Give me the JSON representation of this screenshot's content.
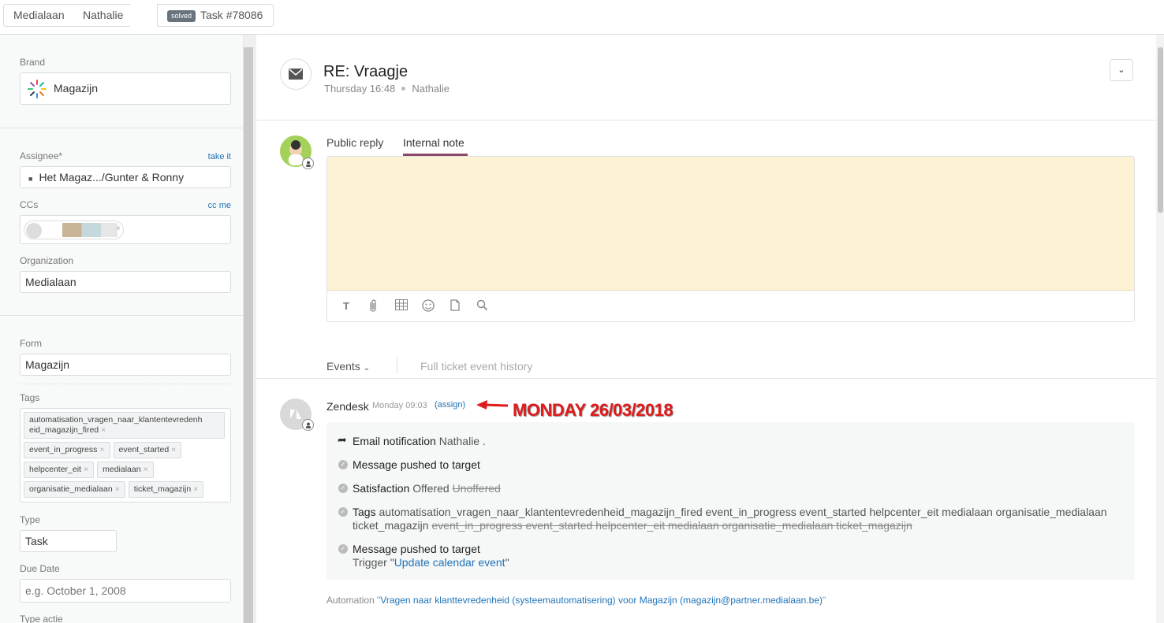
{
  "topbar": {
    "crumb1": "Medialaan",
    "crumb2": "Nathalie",
    "status_badge": "solved",
    "ticket_tab": "Task #78086"
  },
  "sidebar": {
    "brand_label": "Brand",
    "brand_value": "Magazijn",
    "assignee_label": "Assignee*",
    "assignee_link": "take it",
    "assignee_value": "Het Magaz.../Gunter & Ronny",
    "ccs_label": "CCs",
    "ccs_link": "cc me",
    "organization_label": "Organization",
    "organization_value": "Medialaan",
    "form_label": "Form",
    "form_value": "Magazijn",
    "tags_label": "Tags",
    "tags": [
      "automatisation_vragen_naar_klantentevredenh eid_magazijn_fired",
      "event_in_progress",
      "event_started",
      "helpcenter_eit",
      "medialaan",
      "organisatie_medialaan",
      "ticket_magazijn"
    ],
    "type_label": "Type",
    "type_value": "Task",
    "due_label": "Due Date",
    "due_placeholder": "e.g. October 1, 2008",
    "type_actie_label": "Type actie"
  },
  "ticket": {
    "title": "RE: Vraagje",
    "time": "Thursday 16:48",
    "requester": "Nathalie",
    "dropdown_icon": "chevron-down-icon"
  },
  "composer": {
    "tab_public": "Public reply",
    "tab_internal": "Internal note",
    "note_color": "#fdf3d4",
    "tools": [
      "text-format-icon",
      "attachment-icon",
      "table-icon",
      "emoji-icon",
      "document-icon",
      "search-icon"
    ]
  },
  "events_bar": {
    "events_label": "Events",
    "history_label": "Full ticket event history"
  },
  "event": {
    "author": "Zendesk",
    "time": "Monday 09:03",
    "assign": "(assign)",
    "annotation": "MONDAY 26/03/2018",
    "items": {
      "email_title": "Email notification",
      "email_target": "Nathalie .",
      "pushed1": "Message pushed to target",
      "sat_title": "Satisfaction",
      "sat_new": "Offered",
      "sat_old": "Unoffered",
      "tags_title": "Tags",
      "tags_added_1": "automatisation_vragen_naar_klantentevredenheid_magazijn_fired event_in_progress event_started helpcenter_eit medialaan organisatie_medialaan",
      "tags_added_2": "ticket_magazijn",
      "tags_removed": "event_in_progress event_started helpcenter_eit medialaan organisatie_medialaan ticket_magazijn",
      "pushed2": "Message pushed to target",
      "trigger_prefix": "Trigger",
      "trigger_name": "Update calendar event"
    },
    "automation_prefix": "Automation",
    "automation_name": "Vragen naar klanttevredenheid (systeemautomatisering) voor Magazijn (magazijn@partner.medialaan.be)"
  }
}
